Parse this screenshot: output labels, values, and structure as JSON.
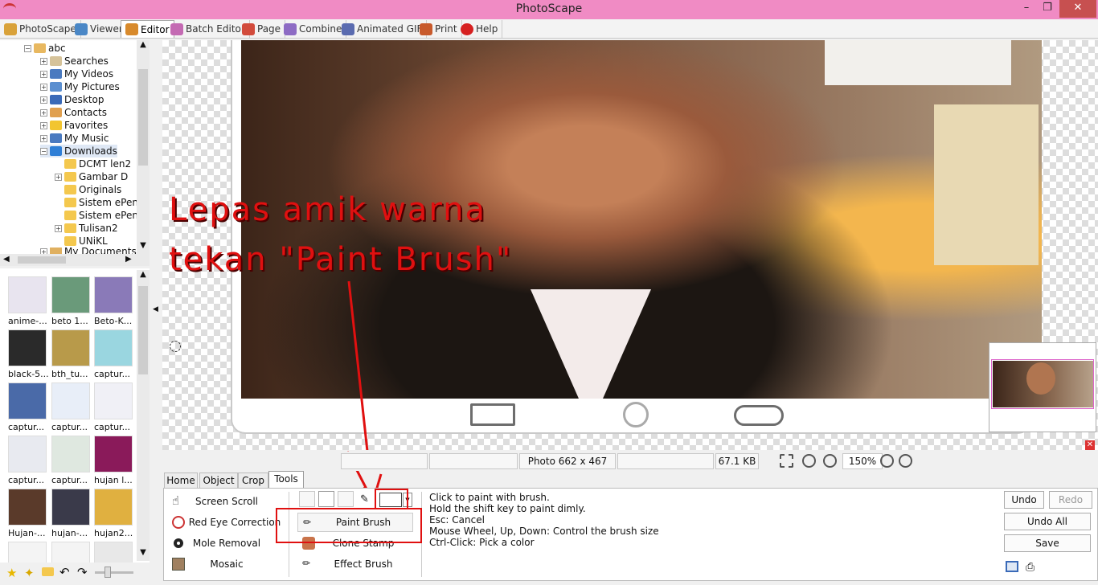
{
  "window": {
    "title": "PhotoScape",
    "minimize": "–",
    "maximize": "❐",
    "close": "✕"
  },
  "main_tabs": [
    {
      "label": "PhotoScape",
      "icon": "photoscape-icon",
      "color": "#d9a23a"
    },
    {
      "label": "Viewer",
      "icon": "viewer-icon",
      "color": "#4a87c6"
    },
    {
      "label": "Editor",
      "icon": "editor-icon",
      "color": "#d88a2c"
    },
    {
      "label": "Batch Editor",
      "icon": "batch-editor-icon",
      "color": "#c46ab3"
    },
    {
      "label": "Page",
      "icon": "page-icon",
      "color": "#d24b3c"
    },
    {
      "label": "Combine",
      "icon": "combine-icon",
      "color": "#8d6bc4"
    },
    {
      "label": "Animated GIF",
      "icon": "animated-gif-icon",
      "color": "#5a6bb0"
    },
    {
      "label": "Print",
      "icon": "print-icon",
      "color": "#c85a2c"
    },
    {
      "label": "Help",
      "icon": "help-icon",
      "color": "#d62020"
    }
  ],
  "active_main_tab": "Editor",
  "folder_tree": {
    "root": "abc",
    "items": [
      "Searches",
      "My Videos",
      "My Pictures",
      "Desktop",
      "Contacts",
      "Favorites",
      "My Music",
      "Downloads"
    ],
    "selected": "Downloads",
    "subfolders": [
      "DCMT len2",
      "Gambar D",
      "Originals",
      "Sistem ePen",
      "Sistem ePen",
      "Tulisan2",
      "UNiKL"
    ],
    "partial": "My Documents"
  },
  "thumbnails": [
    {
      "label": "anime-...",
      "color": "#e8e4ef"
    },
    {
      "label": "beto 1...",
      "color": "#6a9a7a"
    },
    {
      "label": "Beto-K...",
      "color": "#8a7ab8"
    },
    {
      "label": "black-5...",
      "color": "#2a2a2a"
    },
    {
      "label": "bth_tu...",
      "color": "#b89a4a"
    },
    {
      "label": "captur...",
      "color": "#9ad6e0"
    },
    {
      "label": "captur...",
      "color": "#4a6aa8"
    },
    {
      "label": "captur...",
      "color": "#e8eef8"
    },
    {
      "label": "captur...",
      "color": "#f0f0f6"
    },
    {
      "label": "captur...",
      "color": "#e8eaf0"
    },
    {
      "label": "captur...",
      "color": "#dfe8e0"
    },
    {
      "label": "hujan l...",
      "color": "#8a1a5a"
    },
    {
      "label": "Hujan-...",
      "color": "#5a3a2a"
    },
    {
      "label": "hujan-...",
      "color": "#3a3a4a"
    },
    {
      "label": "hujan2...",
      "color": "#e0b040"
    },
    {
      "label": "",
      "color": "#f4f4f4"
    },
    {
      "label": "",
      "color": "#f4f4f4"
    },
    {
      "label": "",
      "color": "#e8e8e8"
    }
  ],
  "annotation": {
    "line1": "Lepas amik warna",
    "line2": "tekan \"Paint Brush\""
  },
  "status": {
    "dimensions": "Photo 662 x 467",
    "file_size": "67.1 KB",
    "zoom": "150%"
  },
  "tool_tabs": [
    "Home",
    "Object",
    "Crop",
    "Tools"
  ],
  "active_tool_tab": "Tools",
  "left_tools": [
    "Screen Scroll",
    "Red Eye Correction",
    "Mole Removal",
    "Mosaic"
  ],
  "brush_tools": [
    "Paint Brush",
    "Clone Stamp",
    "Effect Brush"
  ],
  "brush_color": "#ffffff",
  "help_text": [
    "Click to paint with brush.",
    "Hold the shift key to paint dimly.",
    "Esc: Cancel",
    "Mouse Wheel, Up, Down: Control the brush size",
    "Ctrl-Click: Pick a color"
  ],
  "actions": {
    "undo": "Undo",
    "redo": "Redo",
    "undo_all": "Undo All",
    "save": "Save"
  },
  "accent_red": "#e01010"
}
